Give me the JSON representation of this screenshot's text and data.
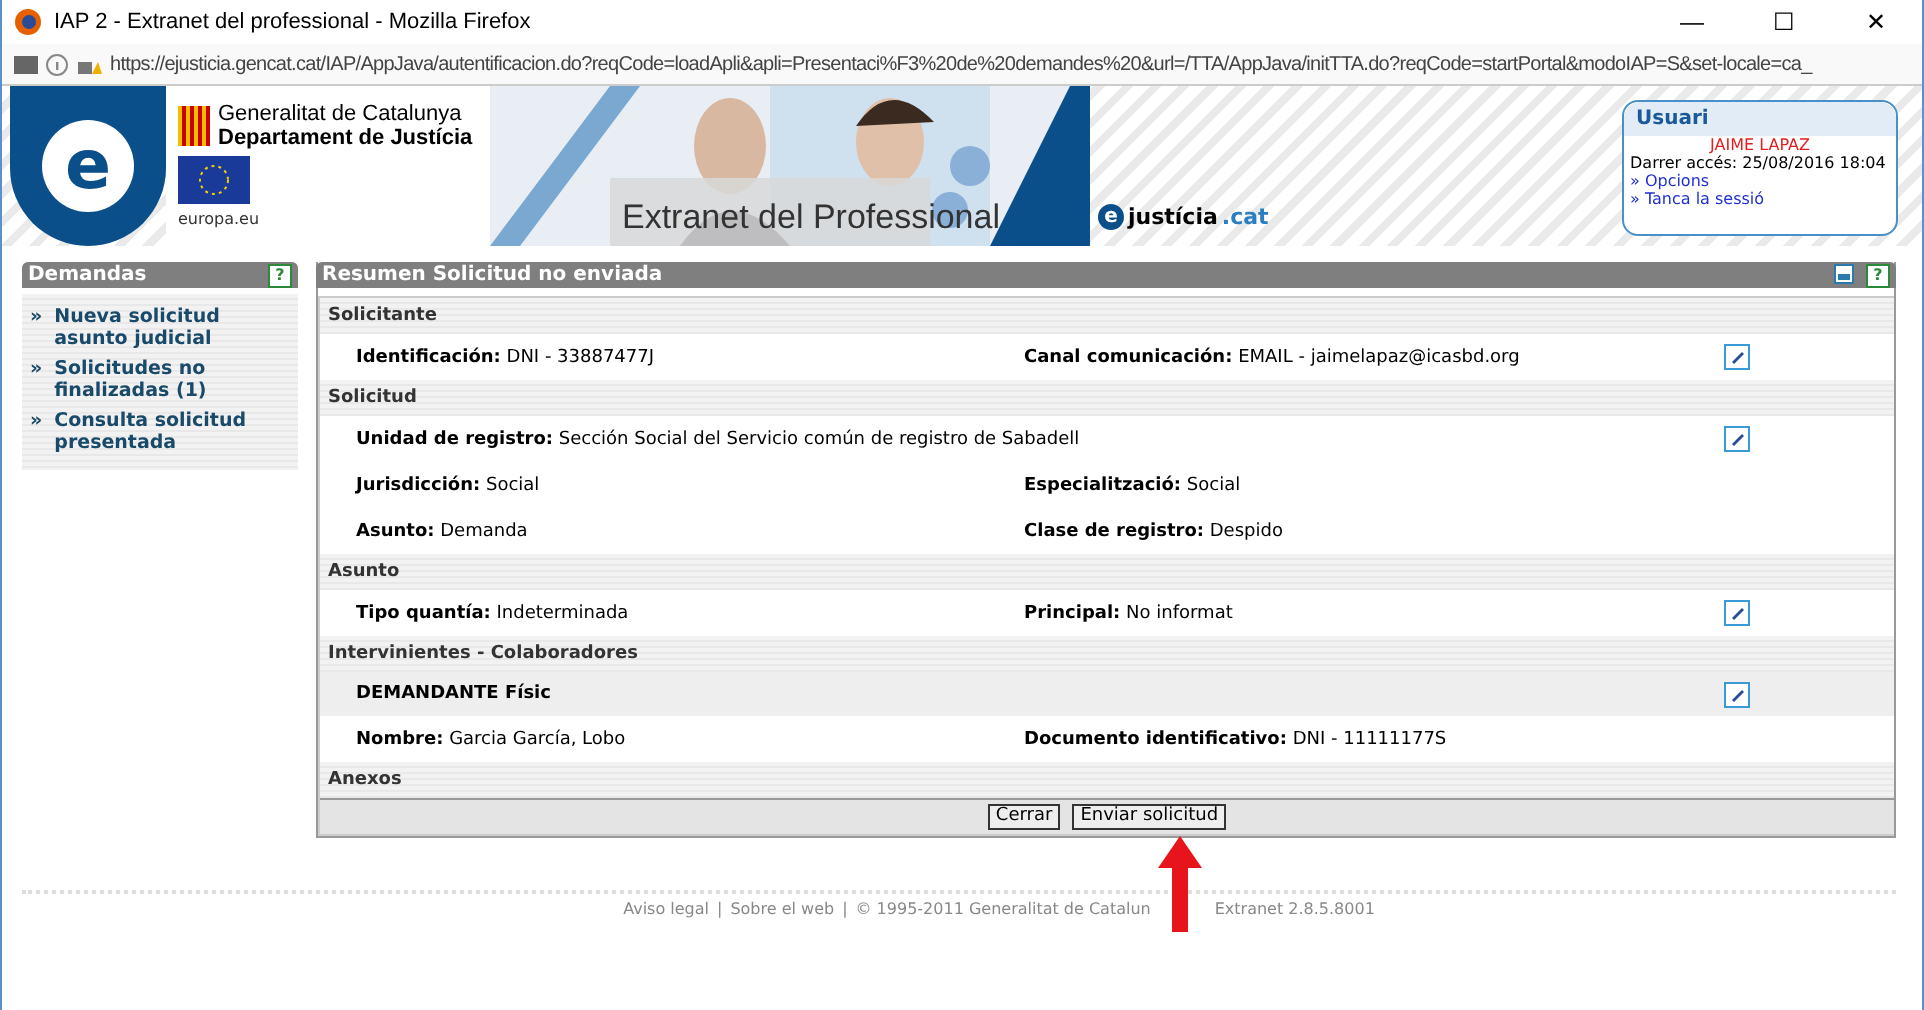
{
  "window": {
    "title": "IAP 2 - Extranet del professional - Mozilla Firefox",
    "controls": [
      "—",
      "☐",
      "✕"
    ]
  },
  "address_bar": {
    "url": "https://ejusticia.gencat.cat/IAP/AppJava/autentificacion.do?reqCode=loadApli&apli=Presentaci%F3%20de%20demandes%20&url=/TTA/AppJava/initTTA.do?reqCode=startPortal&modoIAP=S&set-locale=ca_"
  },
  "banner": {
    "logo_letter": "e",
    "gov_name": "Generalitat de Catalunya",
    "department": "Departament de Justícia",
    "eu_caption": "europa.eu",
    "title": "Extranet del Professional",
    "brand_letter": "e",
    "brand_name": "justícia",
    "brand_tld": ".cat"
  },
  "user_box": {
    "title": "Usuari",
    "name": "JAIME LAPAZ",
    "last_access": "Darrer accés: 25/08/2016 18:04",
    "links": [
      "» Opcions",
      "» Tanca la sessió"
    ]
  },
  "sidebar": {
    "title": "Demandas",
    "help": "?",
    "items": [
      {
        "bullet": "»",
        "label": "Nueva solicitud asunto judicial"
      },
      {
        "bullet": "»",
        "label": "Solicitudes no finalizadas (1)"
      },
      {
        "bullet": "»",
        "label": "Consulta solicitud presentada"
      }
    ]
  },
  "panel": {
    "title": "Resumen Solicitud no enviada",
    "help": "?",
    "sections": [
      {
        "title": "Solicitante",
        "rows": [
          {
            "kind": "fields",
            "editable": true,
            "left": {
              "label": "Identificación:",
              "value": "DNI - 33887477J"
            },
            "right": {
              "label": "Canal comunicación:",
              "value": "EMAIL - jaimelapaz@icasbd.org"
            }
          }
        ]
      },
      {
        "title": "Solicitud",
        "rows": [
          {
            "kind": "fields",
            "editable": true,
            "left": {
              "label": "Unidad de registro:",
              "value": "Sección Social del Servicio común de registro de Sabadell"
            }
          },
          {
            "kind": "fields",
            "editable": false,
            "left": {
              "label": "Jurisdicción:",
              "value": "Social"
            },
            "right": {
              "label": "Especialització:",
              "value": "Social"
            }
          },
          {
            "kind": "fields",
            "editable": false,
            "left": {
              "label": "Asunto:",
              "value": "Demanda"
            },
            "right": {
              "label": "Clase de registro:",
              "value": "Despido"
            }
          }
        ]
      },
      {
        "title": "Asunto",
        "rows": [
          {
            "kind": "fields",
            "editable": true,
            "left": {
              "label": "Tipo quantía:",
              "value": "Indeterminada"
            },
            "right": {
              "label": "Principal:",
              "value": "No informat"
            }
          }
        ]
      },
      {
        "title": "Intervinientes - Colaboradores",
        "rows": [
          {
            "kind": "subheading",
            "editable": true,
            "text": "DEMANDANTE Físic"
          },
          {
            "kind": "fields",
            "editable": false,
            "left": {
              "label": "Nombre:",
              "value": "Garcia García, Lobo"
            },
            "right": {
              "label": "Documento identificativo:",
              "value": "DNI - 11111177S"
            }
          }
        ]
      },
      {
        "title": "Anexos"
      }
    ],
    "buttons": [
      "Cerrar",
      "Enviar solicitud"
    ]
  },
  "footer": {
    "links": [
      "Aviso legal",
      "Sobre el web"
    ],
    "separator": "|",
    "copyright": "© 1995-2011 Generalitat de Catalun",
    "version": "Extranet 2.8.5.8001"
  }
}
